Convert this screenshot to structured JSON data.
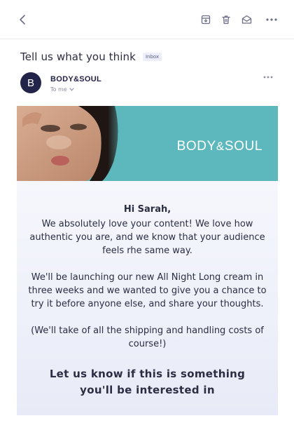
{
  "toolbar": {
    "back_icon": "chevron-left-icon",
    "actions": [
      "archive-icon",
      "trash-icon",
      "mark-read-icon",
      "more-icon"
    ]
  },
  "email": {
    "subject": "Tell us what you think",
    "label": "Inbox",
    "sender": {
      "avatar_letter": "B",
      "name": "BODY&SOUL",
      "to": "To me"
    },
    "banner": {
      "brand_prefix": "BODY",
      "brand_amp": "&",
      "brand_suffix": "SOUL"
    },
    "body": {
      "greeting": "Hi Sarah,",
      "para1": "We absolutely love your content! We love how authentic you are, and we know that your audience feels rhe same way.",
      "para2": "We'll be launching our new All Night Long cream in three weeks and we wanted to give you a chance to try it before anyone else, and share your thoughts.",
      "para3": "(We'll take of all the shipping and handling costs of course!)",
      "cta": "Let us know if this is something you'll be interested in"
    }
  },
  "colors": {
    "accent_dark": "#23244a",
    "banner_teal": "#5db8bd",
    "card_bg": "#eef0fa"
  }
}
